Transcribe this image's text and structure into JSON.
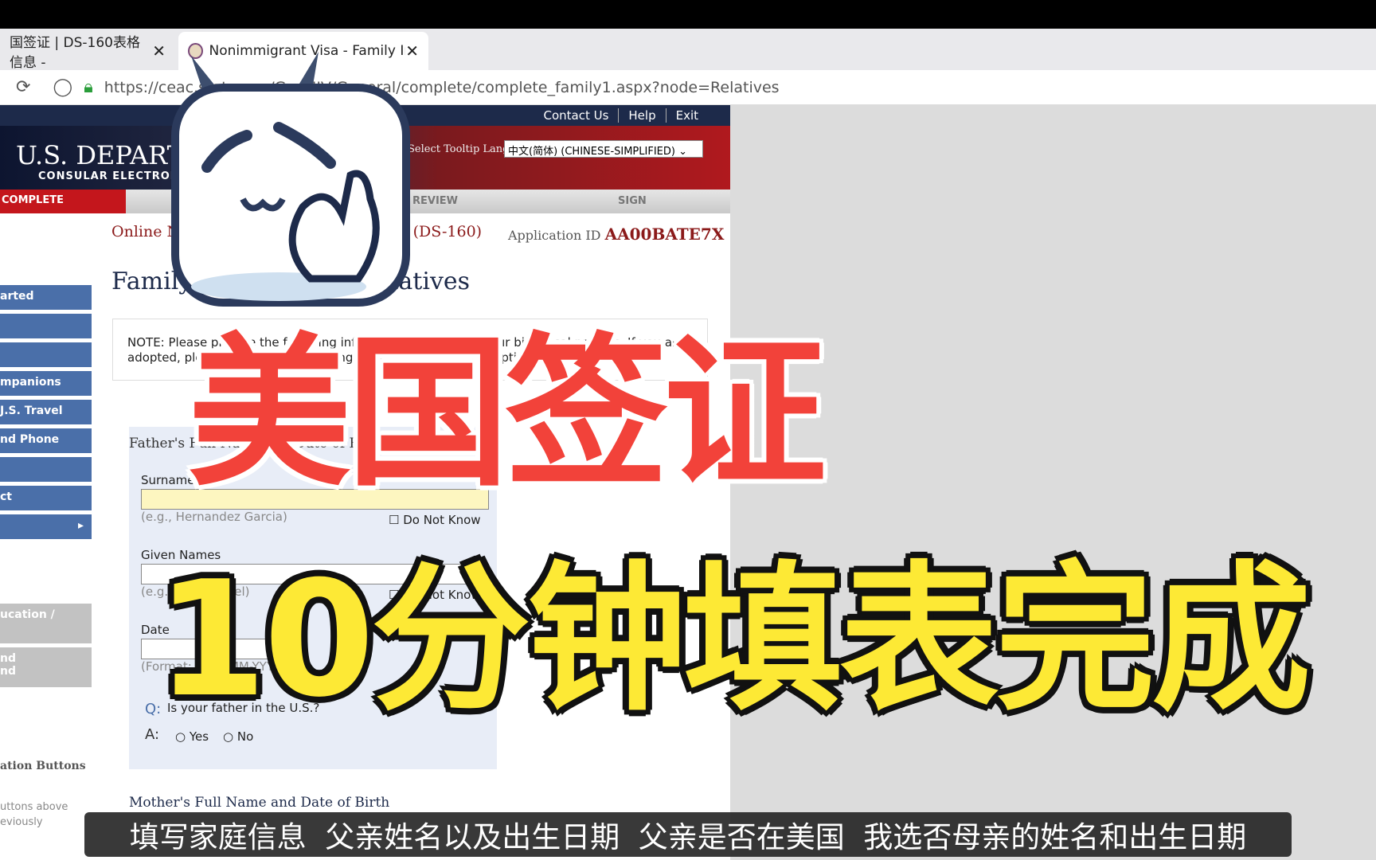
{
  "browser": {
    "tabs": [
      {
        "label": "国签证 | DS-160表格信息 -",
        "close": "✕"
      },
      {
        "label": "Nonimmigrant Visa - Family Info",
        "close": "✕"
      }
    ],
    "new_tab": "+",
    "url": "https://ceac.state.gov/GenNIV/General/complete/complete_family1.aspx?node=Relatives"
  },
  "header": {
    "links": [
      "Contact Us",
      "Help",
      "Exit"
    ],
    "dept": "U.S. DEPARTMENT",
    "dept_sub": "CONSULAR ELECTRONIC",
    "tooltip_label": "Select Tooltip Language",
    "language": "中文(简体)  (CHINESE-SIMPLIFIED)  ⌄"
  },
  "nav": {
    "complete": "COMPLETE",
    "review": "REVIEW",
    "sign": "SIGN"
  },
  "page": {
    "online": "Online Nonimmigrant Visa Application (DS-160)",
    "app_id_label": "Application ID ",
    "app_id": "AA00BATE7X",
    "title": "Family Information: Relatives",
    "note": "NOTE: Please provide the following information concerning your biological parents. If you are adopted, please provide the following information on your adoptive parents."
  },
  "sidebar": {
    "items": [
      "arted",
      "",
      "",
      "mpanions",
      "J.S. Travel",
      "nd Phone",
      "",
      "ct",
      "▸"
    ],
    "gray": [
      "ucation /",
      "nd\nnd"
    ]
  },
  "form": {
    "section": "Father's Full Name and Date of Birth",
    "surname_label": "Surnames",
    "surname_hint": "(e.g., Hernandez Garcia)",
    "do_not_know": "Do Not Know",
    "given_label": "Given Names",
    "given_hint": "(e.g., Juan Miguel)",
    "do_not_know2": "Do Not Know",
    "dob_label": "Date",
    "dob_hint": "(Format: DD-MMM-YYYY)",
    "q": "Q:",
    "question": "Is your father in the U.S.?",
    "a": "A:",
    "yes": "Yes",
    "no": "No",
    "mother_section": "Mother's Full Name and Date of Birth"
  },
  "leftpanel": {
    "nav_buttons": "ation Buttons",
    "nav_text": "uttons above\neviously"
  },
  "overlay": {
    "title1": "美国签证",
    "title2": "10分钟填表完成",
    "subtitle": "填写家庭信息  父亲姓名以及出生日期  父亲是否在美国  我选否母亲的姓名和出生日期"
  },
  "colors": {
    "red": "#f2423a",
    "yellow": "#fde935",
    "nav_blue": "#4a6fa9",
    "banner_red": "#b0191e"
  }
}
